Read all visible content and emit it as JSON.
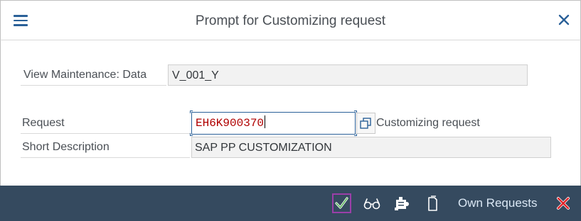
{
  "title": "Prompt for Customizing request",
  "icons": {
    "menu": "hamburger-menu-icon",
    "close": "close-icon",
    "continue": "checkmark-icon",
    "display": "glasses-icon",
    "create_request": "create-request-icon",
    "new": "document-icon",
    "cancel": "cancel-x-icon",
    "value_help": "value-help-icon"
  },
  "view_maintenance": {
    "label": "View Maintenance: Data",
    "value": "V_001_Y"
  },
  "request": {
    "label": "Request",
    "value": "EH6K900370",
    "hint": "Customizing request"
  },
  "short_description": {
    "label": "Short Description",
    "value": "SAP PP CUSTOMIZATION"
  },
  "footer": {
    "own_requests_label": "Own Requests"
  },
  "colors": {
    "footer_bg": "#354a5f",
    "accent": "#2a6098",
    "input_text": "#b00000",
    "continue_highlight": "#9b3fa8",
    "cancel": "#e0242b"
  }
}
